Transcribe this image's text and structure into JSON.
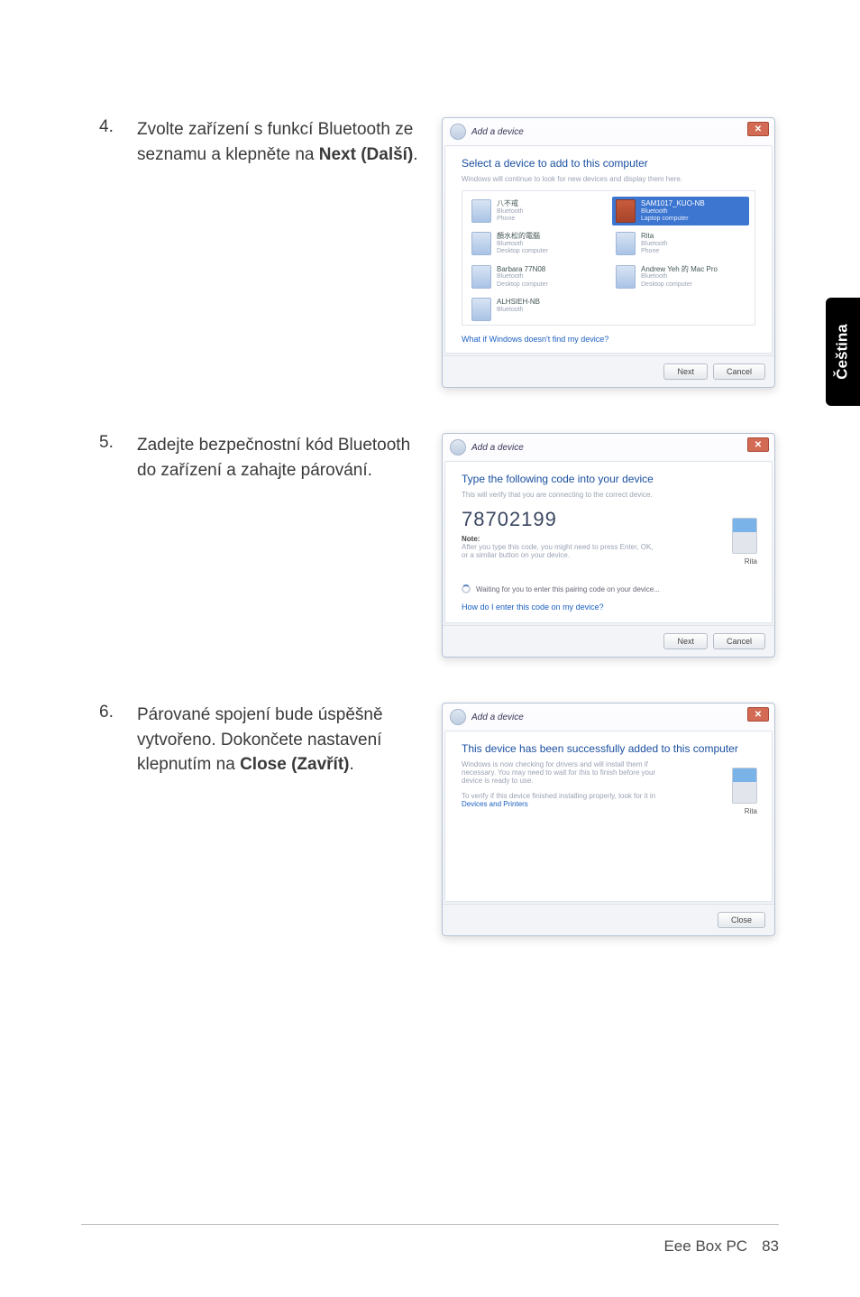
{
  "lang_tab": "Čeština",
  "steps": [
    {
      "num": "4.",
      "text_parts": [
        "Zvolte zařízení s funkcí Bluetooth ze seznamu a klepněte na ",
        "Next (Další)",
        "."
      ]
    },
    {
      "num": "5.",
      "text_parts": [
        "Zadejte bezpečnostní kód Bluetooth do zařízení a zahajte párování."
      ]
    },
    {
      "num": "6.",
      "text_parts": [
        "Párované spojení bude úspěšně vytvořeno. Dokončete nastavení klepnutím na ",
        "Close (Zavřít)",
        "."
      ]
    }
  ],
  "dialog1": {
    "title": "Add a device",
    "heading": "Select a device to add to this computer",
    "sub": "Windows will continue to look for new devices and display them here.",
    "devices": [
      {
        "name": "八不戒",
        "l2": "Bluetooth",
        "l3": "Phone"
      },
      {
        "name": "SAM1017_KUO-NB",
        "l2": "Bluetooth",
        "l3": "Laptop computer",
        "selected": true
      },
      {
        "name": "顏水松的電腦",
        "l2": "Bluetooth",
        "l3": "Desktop computer"
      },
      {
        "name": "Rita",
        "l2": "Bluetooth",
        "l3": "Phone"
      },
      {
        "name": "Barbara 77N08",
        "l2": "Bluetooth",
        "l3": "Desktop computer"
      },
      {
        "name": "Andrew Yeh 的 Mac Pro",
        "l2": "Bluetooth",
        "l3": "Desktop computer"
      },
      {
        "name": "ALHSIEH-NB",
        "l2": "Bluetooth",
        "l3": ""
      }
    ],
    "link": "What if Windows doesn't find my device?",
    "btn_next": "Next",
    "btn_cancel": "Cancel"
  },
  "dialog2": {
    "title": "Add a device",
    "heading": "Type the following code into your device",
    "sub": "This will verify that you are connecting to the correct device.",
    "code": "78702199",
    "note_label": "Note:",
    "note": "After you type this code, you might need to press Enter, OK, or a similar button on your device.",
    "waiting": "Waiting for you to enter this pairing code on your device...",
    "link": "How do I enter this code on my device?",
    "side_label": "Rita",
    "btn_next": "Next",
    "btn_cancel": "Cancel"
  },
  "dialog3": {
    "title": "Add a device",
    "heading": "This device has been successfully added to this computer",
    "body1": "Windows is now checking for drivers and will install them if necessary. You may need to wait for this to finish before your device is ready to use.",
    "body2": "To verify if this device finished installing properly, look for it in",
    "link": "Devices and Printers",
    "side_label": "Rita",
    "btn_close": "Close"
  },
  "footer": {
    "product": "Eee Box PC",
    "page": "83"
  }
}
